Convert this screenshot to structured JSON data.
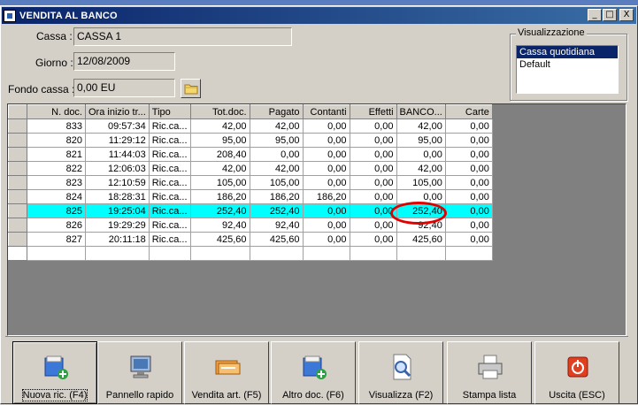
{
  "window": {
    "title": "VENDITA AL BANCO",
    "min_glyph": "_",
    "max_glyph": "□",
    "close_glyph": "X"
  },
  "form": {
    "cassa_label": "Cassa :",
    "cassa_value": "CASSA 1",
    "giorno_label": "Giorno :",
    "giorno_value": "12/08/2009",
    "fondo_label": "Fondo cassa :",
    "fondo_value": "0,00 EU"
  },
  "view": {
    "legend": "Visualizzazione",
    "options": [
      "Cassa quotidiana",
      "Default"
    ],
    "selected": "Cassa quotidiana"
  },
  "grid": {
    "columns": [
      "N. doc.",
      "Ora inizio tr...",
      "Tipo",
      "Tot.doc.",
      "Pagato",
      "Contanti",
      "Effetti",
      "BANCO...",
      "Carte"
    ],
    "rows": [
      [
        "833",
        "09:57:34",
        "Ric.ca...",
        "42,00",
        "42,00",
        "0,00",
        "0,00",
        "42,00",
        "0,00"
      ],
      [
        "820",
        "11:29:12",
        "Ric.ca...",
        "95,00",
        "95,00",
        "0,00",
        "0,00",
        "95,00",
        "0,00"
      ],
      [
        "821",
        "11:44:03",
        "Ric.ca...",
        "208,40",
        "0,00",
        "0,00",
        "0,00",
        "0,00",
        "0,00"
      ],
      [
        "822",
        "12:06:03",
        "Ric.ca...",
        "42,00",
        "42,00",
        "0,00",
        "0,00",
        "42,00",
        "0,00"
      ],
      [
        "823",
        "12:10:59",
        "Ric.ca...",
        "105,00",
        "105,00",
        "0,00",
        "0,00",
        "105,00",
        "0,00"
      ],
      [
        "824",
        "18:28:31",
        "Ric.ca...",
        "186,20",
        "186,20",
        "186,20",
        "0,00",
        "0,00",
        "0,00"
      ],
      [
        "825",
        "19:25:04",
        "Ric.ca...",
        "252,40",
        "252,40",
        "0,00",
        "0,00",
        "252,40",
        "0,00"
      ],
      [
        "826",
        "19:29:29",
        "Ric.ca...",
        "92,40",
        "92,40",
        "0,00",
        "0,00",
        "92,40",
        "0,00"
      ],
      [
        "827",
        "20:11:18",
        "Ric.ca...",
        "425,60",
        "425,60",
        "0,00",
        "0,00",
        "425,60",
        "0,00"
      ]
    ],
    "highlighted_row": 6
  },
  "toolbar": [
    {
      "label": "Nuova ric. (F4)",
      "icon": "new-receipt-icon"
    },
    {
      "label": "Pannello rapido",
      "icon": "monitor-icon"
    },
    {
      "label": "Vendita art. (F5)",
      "icon": "sale-card-icon"
    },
    {
      "label": "Altro doc. (F6)",
      "icon": "other-doc-icon"
    },
    {
      "label": "Visualizza (F2)",
      "icon": "magnifier-doc-icon"
    },
    {
      "label": "Stampa lista",
      "icon": "printer-icon"
    },
    {
      "label": "Uscita (ESC)",
      "icon": "exit-icon"
    }
  ],
  "colors": {
    "title_start": "#0a246a",
    "title_end": "#3a6ea5",
    "row_highlight": "#00ffff",
    "annotation": "#e00000"
  }
}
